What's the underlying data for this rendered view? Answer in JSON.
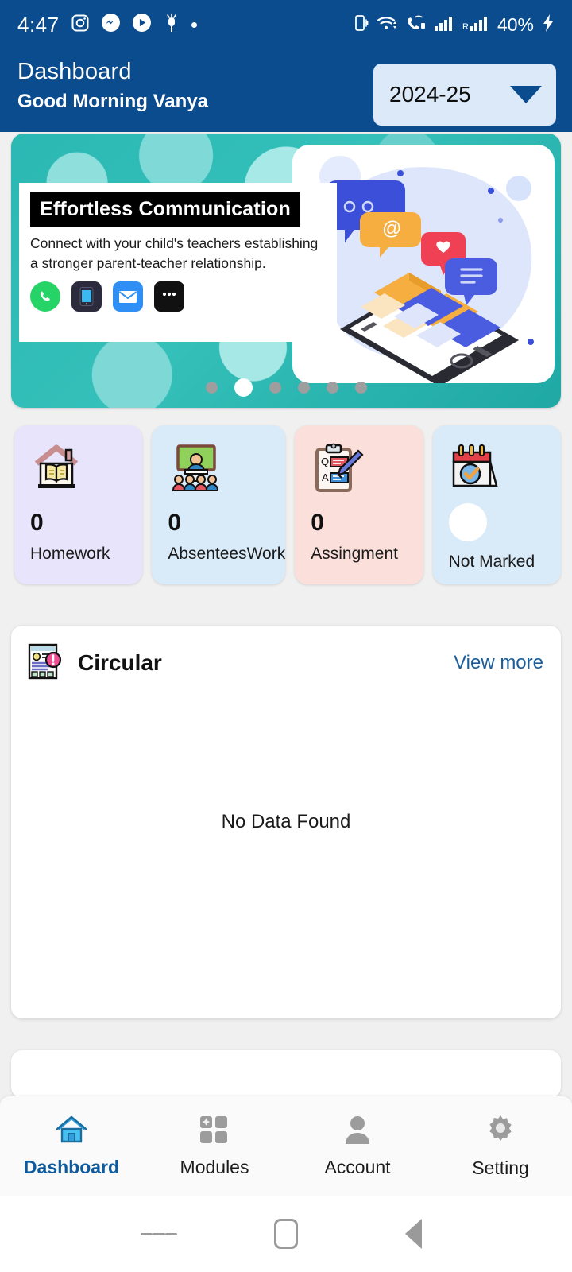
{
  "status_bar": {
    "time": "4:47",
    "left_icons": [
      "instagram-icon",
      "messenger-icon",
      "play-icon",
      "scooter-icon",
      "dot-icon"
    ],
    "right_icons": [
      "vibrate-icon",
      "wifi-icon",
      "vowifi-call-icon",
      "signal-bars-icon",
      "roaming-signal-icon"
    ],
    "battery": "40%",
    "charging": true
  },
  "header": {
    "title": "Dashboard",
    "greeting": "Good Morning Vanya",
    "year_selected": "2024-25"
  },
  "banner": {
    "heading": "Effortless Communication",
    "body": "Connect with your child's teachers establishing a stronger parent-teacher relationship.",
    "channel_icons": [
      "whatsapp-icon",
      "mobile-phone-icon",
      "email-icon",
      "chat-bubble-icon"
    ],
    "dot_count": 6,
    "active_dot": 2
  },
  "stats": [
    {
      "label": "Homework",
      "value": "0",
      "icon": "house-book-icon",
      "bg": "#e8e4fb"
    },
    {
      "label": "AbsenteesWork",
      "value": "0",
      "icon": "classroom-icon",
      "bg": "#d9eaf9"
    },
    {
      "label": "Assingment",
      "value": "0",
      "icon": "clipboard-pen-icon",
      "bg": "#fbdfdb"
    },
    {
      "label": "Not Marked",
      "value": "",
      "icon": "calendar-check-icon",
      "bg": "#d9eaf9"
    }
  ],
  "circular": {
    "title": "Circular",
    "icon": "newspaper-alert-icon",
    "view_more": "View more",
    "empty_text": "No Data Found"
  },
  "bottom_nav": [
    {
      "label": "Dashboard",
      "icon": "home-icon",
      "active": true
    },
    {
      "label": "Modules",
      "icon": "grid-icon",
      "active": false
    },
    {
      "label": "Account",
      "icon": "person-icon",
      "active": false
    },
    {
      "label": "Setting",
      "icon": "gear-icon",
      "active": false
    }
  ],
  "android_nav": [
    "recents-icon",
    "home-square-icon",
    "back-triangle-icon"
  ],
  "colors": {
    "header_blue": "#0a4c8e",
    "accent_link": "#1c5d9b",
    "page_bg": "#f0f0f0"
  }
}
